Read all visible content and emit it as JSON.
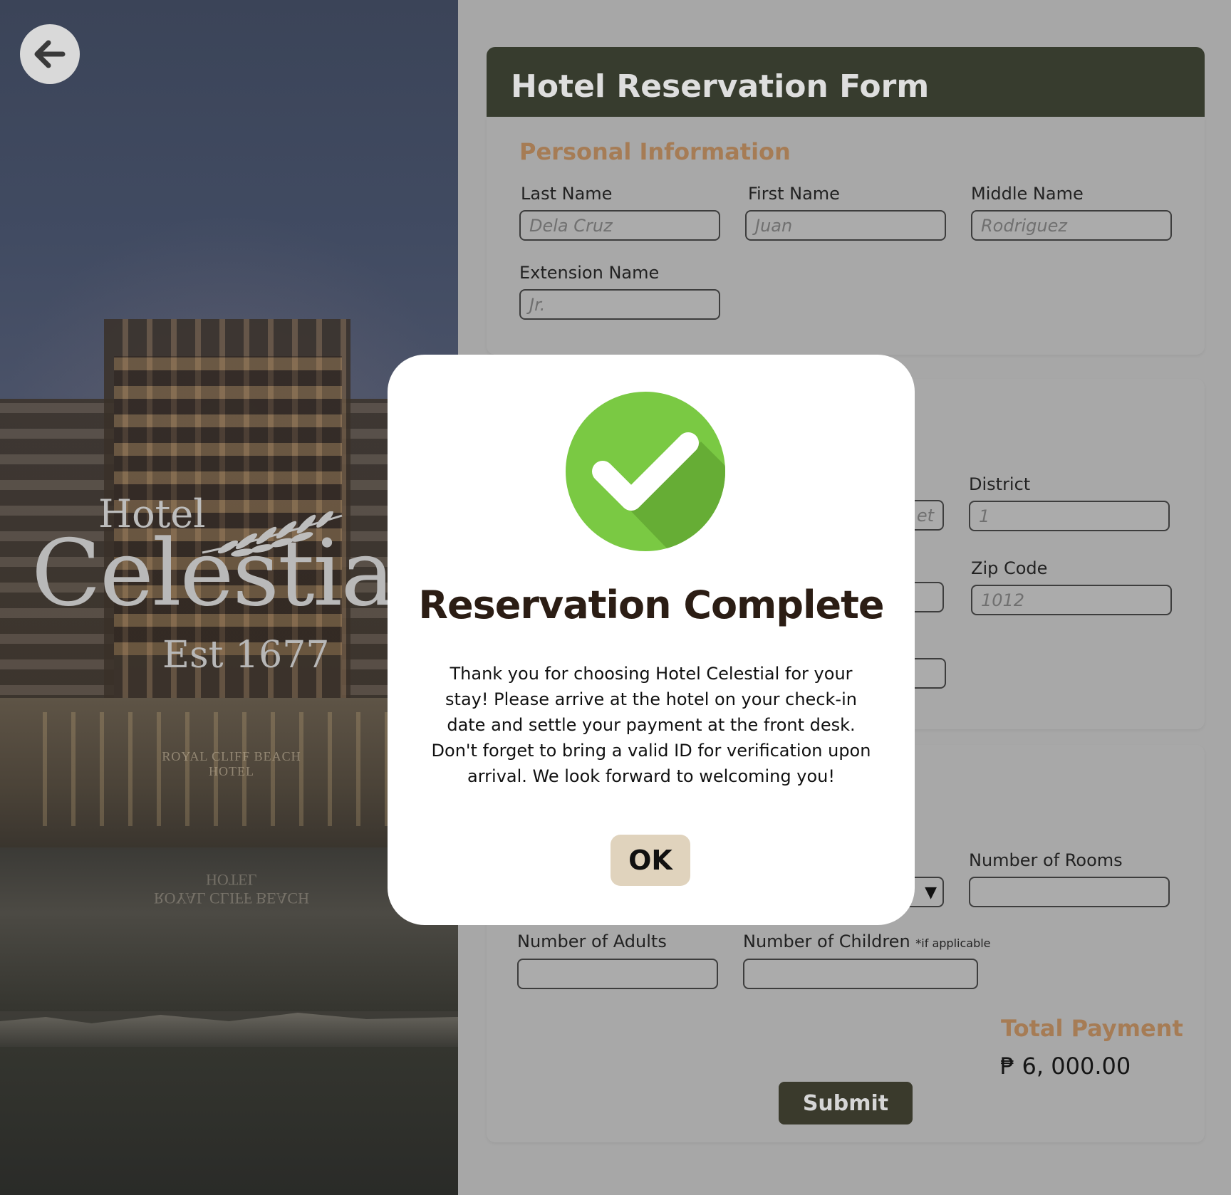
{
  "brand": {
    "hotel": "Hotel",
    "name": "Celestia",
    "est": "Est 1677",
    "sign": "ROYAL CLIFF BEACH HOTEL",
    "sign_reflection": "ROYAL CLIFF BEACH HOTEL"
  },
  "form": {
    "title": "Hotel Reservation Form",
    "personal": {
      "heading": "Personal Information",
      "last_name_label": "Last Name",
      "last_name_placeholder": "Dela Cruz",
      "first_name_label": "First Name",
      "first_name_placeholder": "Juan",
      "middle_name_label": "Middle Name",
      "middle_name_placeholder": "Rodriguez",
      "extension_label": "Extension Name",
      "extension_placeholder": "Jr."
    },
    "address": {
      "street_placeholder_fragment": "et",
      "district_label": "District",
      "district_placeholder": "1",
      "zip_label": "Zip Code",
      "zip_placeholder": "1012"
    },
    "booking": {
      "rooms_label": "Number of Rooms",
      "adults_label": "Number of Adults",
      "children_label": "Number of Children",
      "children_note": "*if applicable",
      "dropdown_arrow": "▼"
    },
    "total_label": "Total Payment",
    "total_value": "₱ 6, 000.00",
    "submit_label": "Submit"
  },
  "modal": {
    "title": "Reservation Complete",
    "message": "Thank you for choosing Hotel Celestial for your stay! Please arrive at the hotel on your check-in date and settle your payment at the front desk. Don't forget to bring a valid ID for verification upon arrival. We look forward to welcoming you!",
    "ok_label": "OK"
  },
  "icons": {
    "back": "arrow-left-icon",
    "check": "checkmark-circle-icon",
    "laurel": "laurel-branch-icon"
  },
  "colors": {
    "header_bg": "#373c2e",
    "accent": "#a67c55",
    "success_green": "#7ac943",
    "ok_button": "#e0d3bd",
    "submit_bg": "#3a3a2c"
  }
}
